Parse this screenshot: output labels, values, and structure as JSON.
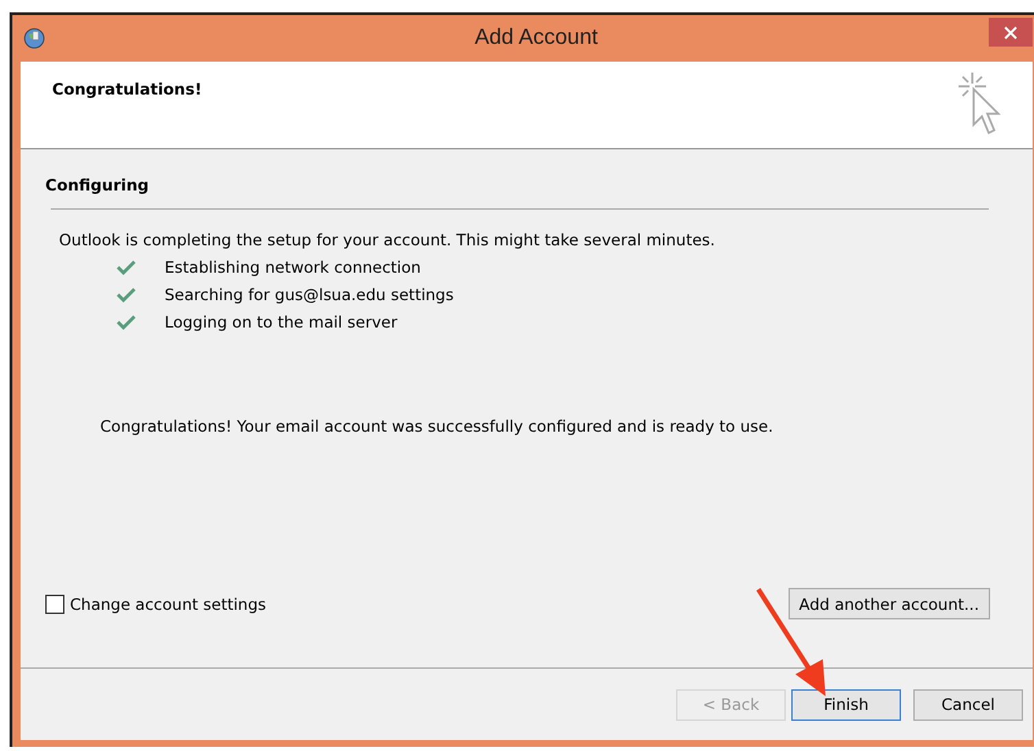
{
  "window": {
    "title": "Add Account"
  },
  "header": {
    "title": "Congratulations!"
  },
  "section": {
    "title": "Configuring"
  },
  "intro": "Outlook is completing the setup for your account. This might take several minutes.",
  "steps": [
    {
      "label": "Establishing network connection",
      "done": true
    },
    {
      "label": "Searching for gus@lsua.edu settings",
      "done": true
    },
    {
      "label": "Logging on to the mail server",
      "done": true
    }
  ],
  "message": "Congratulations! Your email account was successfully configured and is ready to use.",
  "change_settings": {
    "label": "Change account settings",
    "checked": false
  },
  "add_another": "Add another account...",
  "buttons": [
    {
      "label": "< Back",
      "disabled": true,
      "default": false
    },
    {
      "label": "Finish",
      "disabled": false,
      "default": true
    },
    {
      "label": "Cancel",
      "disabled": false,
      "default": false
    }
  ]
}
